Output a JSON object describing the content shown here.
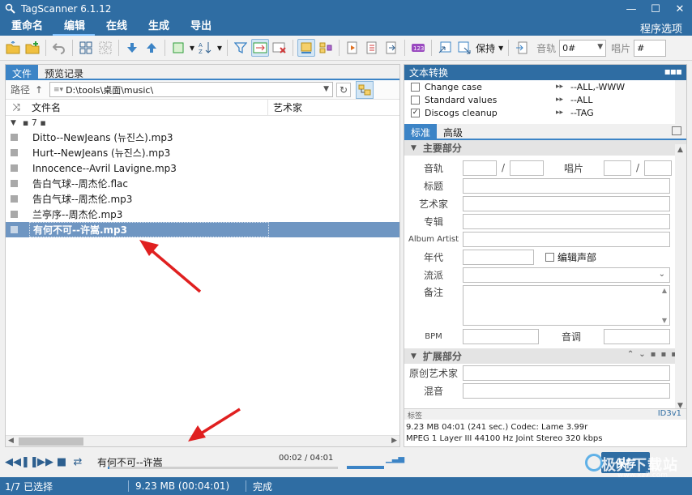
{
  "window": {
    "title": "TagScanner 6.1.12",
    "min": "—",
    "max": "☐",
    "close": "✕"
  },
  "menu": {
    "items": [
      "重命名",
      "编辑",
      "在线",
      "生成",
      "导出"
    ],
    "right": "程序选项"
  },
  "toolbar": {
    "keep_label": "保持",
    "track_label": "音轨",
    "track_value": "0#",
    "disc_label": "唱片",
    "disc_value": "#"
  },
  "left": {
    "tabs": [
      "文件",
      "预览记录"
    ],
    "path_label": "路径",
    "path_value": "D:\\tools\\桌面\\music\\",
    "col_filename": "文件名",
    "col_artist": "艺术家",
    "group_label": "▪ 7 ▪",
    "files": [
      "Ditto--NewJeans (뉴진스).mp3",
      "Hurt--NewJeans (뉴진스).mp3",
      "Innocence--Avril Lavigne.mp3",
      "告白气球--周杰伦.flac",
      "告白气球--周杰伦.mp3",
      "兰亭序--周杰伦.mp3",
      "有何不可--许嵩.mp3"
    ],
    "selected_index": 6
  },
  "player": {
    "track": "有何不可--许嵩",
    "time": "00:02 / 04:01"
  },
  "right": {
    "conv_title": "文本转换",
    "conversions": [
      {
        "name": "Change case",
        "checked": false,
        "value": "--ALL,-WWW"
      },
      {
        "name": "Standard values",
        "checked": false,
        "value": "--ALL"
      },
      {
        "name": "Discogs cleanup",
        "checked": true,
        "value": "--TAG"
      }
    ],
    "tabs": [
      "标准",
      "高级"
    ],
    "section_main": "主要部分",
    "section_ext": "扩展部分",
    "fields": {
      "track": "音轨",
      "disc": "唱片",
      "title": "标题",
      "artist": "艺术家",
      "album": "专辑",
      "album_artist": "Album Artist",
      "year": "年代",
      "edit_channel": "编辑声部",
      "genre": "流派",
      "comment": "备注",
      "bpm": "BPM",
      "key": "音调",
      "orig_artist": "原创艺术家",
      "mix": "混音"
    },
    "tagbar_left": "标签",
    "tagbar_right": "ID3v1",
    "info_line1": "9.23 MB  04:01 (241 sec.)  Codec: Lame 3.99r",
    "info_line2": "MPEG 1 Layer III  44100 Hz  Joint Stereo  320 kbps",
    "save": "保存"
  },
  "status": {
    "selected": "1/7 已选择",
    "size": "9.23 MB (00:04:01)",
    "state": "完成"
  },
  "watermark": {
    "text": "极光下载站",
    "url": "www.xz7.com"
  }
}
